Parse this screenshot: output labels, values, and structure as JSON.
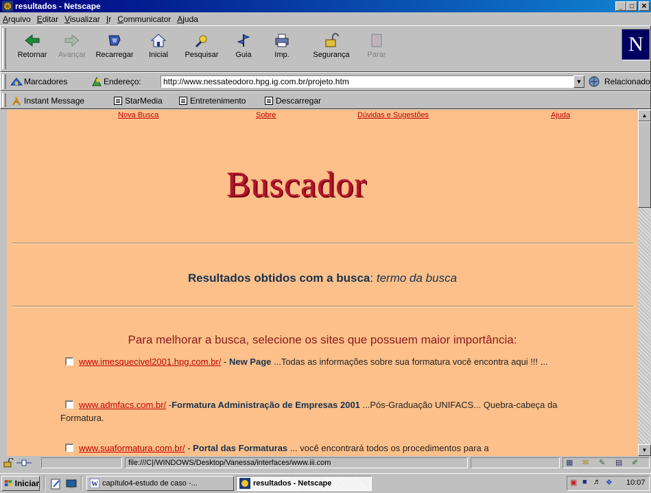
{
  "window": {
    "title": "resultados - Netscape",
    "minimize": "_",
    "maximize": "□",
    "close": "✕"
  },
  "menu": [
    "Arquivo",
    "Editar",
    "Visualizar",
    "Ir",
    "Communicator",
    "Ajuda"
  ],
  "nav_toolbar": {
    "buttons": [
      {
        "label": "Retornar",
        "icon": "back-arrow-icon",
        "enabled": true
      },
      {
        "label": "Avançar",
        "icon": "forward-arrow-icon",
        "enabled": false
      },
      {
        "label": "Recarregar",
        "icon": "reload-icon",
        "enabled": true
      },
      {
        "label": "Inicial",
        "icon": "home-icon",
        "enabled": true
      },
      {
        "label": "Pesquisar",
        "icon": "search-icon",
        "enabled": true
      },
      {
        "label": "Guia",
        "icon": "guide-icon",
        "enabled": true
      },
      {
        "label": "Imp.",
        "icon": "print-icon",
        "enabled": true
      },
      {
        "label": "Segurança",
        "icon": "lock-icon",
        "enabled": true
      },
      {
        "label": "Parar",
        "icon": "stop-icon",
        "enabled": false
      }
    ],
    "logo": "N"
  },
  "location": {
    "bookmarks_label": "Marcadores",
    "address_label": "Endereço:",
    "url": "http://www.nessateodoro.hpg.ig.com.br/projeto.htm",
    "related_label": "Relacionados"
  },
  "personal_toolbar": [
    "Instant Message",
    "StarMedia",
    "Entretenimento",
    "Descarregar"
  ],
  "page": {
    "top_links": [
      "Nova Busca",
      "Sobre",
      "Dúvidas e Sugestões",
      "Ajuda"
    ],
    "logo_text": "Buscador",
    "results_prefix": "Resultados obtidos com a busca",
    "results_sep": ":",
    "search_term": "termo da busca",
    "improve_text": "Para melhorar a busca, selecione os sites que possuem maior importância:",
    "results": [
      {
        "url": "www.imesquecivel2001.hpg.com.br/",
        "sep": " - ",
        "title": "New Page",
        "desc": " ...Todas as informações sobre sua formatura você encontra aqui !!! ..."
      },
      {
        "url": "www.admfacs.com.br/",
        "sep": " -",
        "title": "Formatura Administração de Empresas 2001",
        "desc": " ...Pós-Graduação UNIFACS... Quebra-cabeça da Formatura."
      },
      {
        "url": "www.suaformatura.com.br/",
        "sep": " - ",
        "title": "Portal das Formaturas",
        "desc": " ... você encontrará todos os procedimentos para a"
      }
    ]
  },
  "status": {
    "text": "file:///C|/WINDOWS/Desktop/Vanessa/interfaces/www.iii.com"
  },
  "taskbar": {
    "start_label": "Iniciar",
    "tasks": [
      "capítulo4-estudo de caso -...",
      "resultados - Netscape"
    ],
    "clock": "10:07"
  },
  "colors": {
    "page_bg": "#fdc08a",
    "link": "#c00000",
    "heading": "#16324e",
    "accent": "#8b1a1a"
  }
}
